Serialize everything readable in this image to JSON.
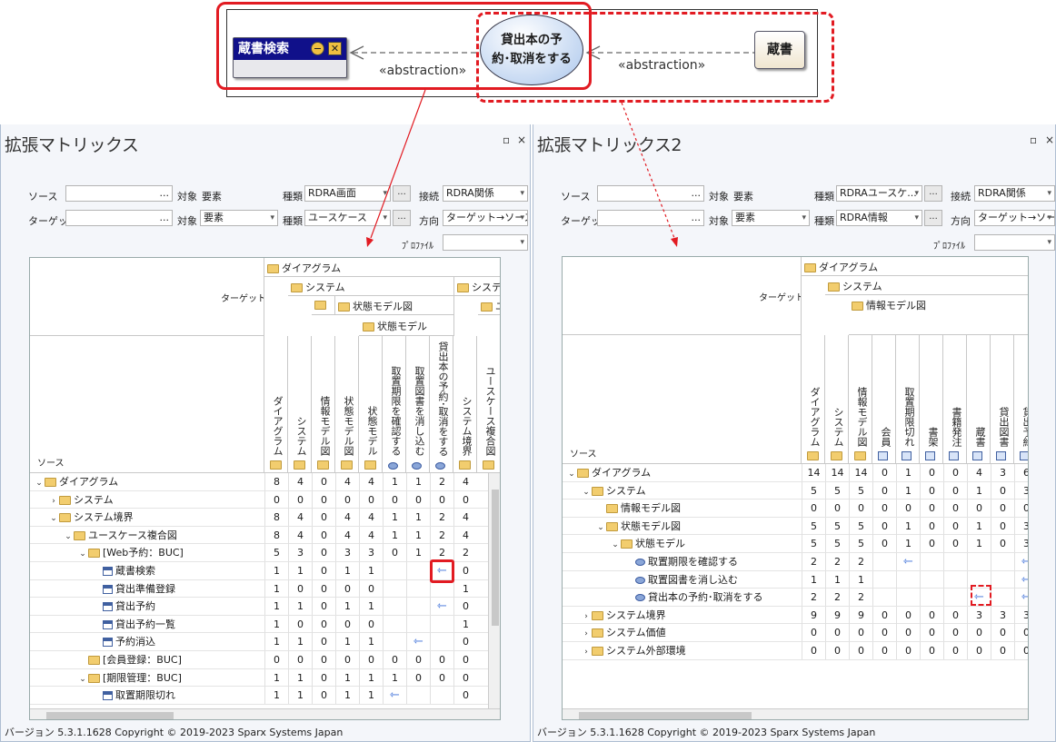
{
  "diagram": {
    "screen_name": "蔵書検索",
    "usecase_line1": "貸出本の予",
    "usecase_line2": "約･取消をする",
    "info_name": "蔵書",
    "abstraction_left": "«abstraction»",
    "abstraction_right": "«abstraction»"
  },
  "panel1": {
    "title": "拡張マトリックス",
    "source_label": "ソース",
    "target_label": "ターゲット",
    "target_kw": "対象",
    "source_target_val": "要素",
    "target_target_val": "要素",
    "kind_label": "種類",
    "source_kind": "RDRA画面",
    "target_kind": "ユースケース",
    "connect_label": "接続",
    "connect_val": "RDRA関係",
    "direction_label": "方向",
    "direction_val": "ターゲット→ソース",
    "profile_label": "ﾌﾟﾛﾌｧｲﾙ",
    "grid_target": "ターゲット",
    "grid_source": "ソース",
    "groups": [
      "ダイアグラム",
      "システム",
      "状態モデル図",
      "状態モデル",
      "システム",
      "ユ"
    ],
    "cols": [
      "ダイアグラム",
      "システム",
      "情報モデル図",
      "状態モデル図",
      "状態モデル",
      "取置期限を確認する",
      "取置図書を消し込む",
      "貸出本の予約･取消をする",
      "システム境界",
      "ユースケース複合図"
    ],
    "rows": [
      {
        "label": "ダイアグラム",
        "vals": [
          "8",
          "4",
          "0",
          "4",
          "4",
          "1",
          "1",
          "2",
          "4"
        ]
      },
      {
        "label": "システム",
        "vals": [
          "0",
          "0",
          "0",
          "0",
          "0",
          "0",
          "0",
          "0",
          "0"
        ]
      },
      {
        "label": "システム境界",
        "vals": [
          "8",
          "4",
          "0",
          "4",
          "4",
          "1",
          "1",
          "2",
          "4"
        ]
      },
      {
        "label": "ユースケース複合図",
        "vals": [
          "8",
          "4",
          "0",
          "4",
          "4",
          "1",
          "1",
          "2",
          "4"
        ]
      },
      {
        "label": "[Web予約：BUC]",
        "vals": [
          "5",
          "3",
          "0",
          "3",
          "3",
          "0",
          "1",
          "2",
          "2"
        ]
      },
      {
        "label": "蔵書検索",
        "vals": [
          "1",
          "1",
          "0",
          "1",
          "1",
          "",
          "",
          "⇽",
          "0"
        ]
      },
      {
        "label": "貸出準備登録",
        "vals": [
          "1",
          "0",
          "0",
          "0",
          "0",
          "",
          "",
          "",
          "1"
        ]
      },
      {
        "label": "貸出予約",
        "vals": [
          "1",
          "1",
          "0",
          "1",
          "1",
          "",
          "",
          "⇽",
          "0"
        ]
      },
      {
        "label": "貸出予約一覧",
        "vals": [
          "1",
          "0",
          "0",
          "0",
          "0",
          "",
          "",
          "",
          "1"
        ]
      },
      {
        "label": "予約消込",
        "vals": [
          "1",
          "1",
          "0",
          "1",
          "1",
          "",
          "⇽",
          "",
          "0"
        ]
      },
      {
        "label": "[会員登録：BUC]",
        "vals": [
          "0",
          "0",
          "0",
          "0",
          "0",
          "0",
          "0",
          "0",
          "0"
        ]
      },
      {
        "label": "[期限管理：BUC]",
        "vals": [
          "1",
          "1",
          "0",
          "1",
          "1",
          "1",
          "0",
          "0",
          "0"
        ]
      },
      {
        "label": "取置期限切れ",
        "vals": [
          "1",
          "1",
          "0",
          "1",
          "1",
          "⇽",
          "",
          "",
          "0"
        ]
      }
    ]
  },
  "panel2": {
    "title": "拡張マトリックス2",
    "source_kind": "RDRAユースケ...",
    "target_kind": "RDRA情報",
    "connect_val": "RDRA関係",
    "direction_val": "ターゲット→ソース",
    "groups": [
      "ダイアグラム",
      "システム",
      "情報モデル図"
    ],
    "cols": [
      "ダイアグラム",
      "システム",
      "情報モデル図",
      "会員",
      "取置期限切れ",
      "書架",
      "書籍発注",
      "蔵書",
      "貸出図書",
      "貸出予約"
    ],
    "rows": [
      {
        "label": "ダイアグラム",
        "vals": [
          "14",
          "14",
          "14",
          "0",
          "1",
          "0",
          "0",
          "4",
          "3",
          "6"
        ]
      },
      {
        "label": "システム",
        "vals": [
          "5",
          "5",
          "5",
          "0",
          "1",
          "0",
          "0",
          "1",
          "0",
          "3"
        ]
      },
      {
        "label": "情報モデル図",
        "vals": [
          "0",
          "0",
          "0",
          "0",
          "0",
          "0",
          "0",
          "0",
          "0",
          "0"
        ]
      },
      {
        "label": "状態モデル図",
        "vals": [
          "5",
          "5",
          "5",
          "0",
          "1",
          "0",
          "0",
          "1",
          "0",
          "3"
        ]
      },
      {
        "label": "状態モデル",
        "vals": [
          "5",
          "5",
          "5",
          "0",
          "1",
          "0",
          "0",
          "1",
          "0",
          "3"
        ]
      },
      {
        "label": "取置期限を確認する",
        "vals": [
          "2",
          "2",
          "2",
          "",
          "⇽",
          "",
          "",
          "",
          "",
          "⇽"
        ]
      },
      {
        "label": "取置図書を消し込む",
        "vals": [
          "1",
          "1",
          "1",
          "",
          "",
          "",
          "",
          "",
          "",
          "⇽"
        ]
      },
      {
        "label": "貸出本の予約･取消をする",
        "vals": [
          "2",
          "2",
          "2",
          "",
          "",
          "",
          "",
          "⇽",
          "",
          "⇽"
        ]
      },
      {
        "label": "システム境界",
        "vals": [
          "9",
          "9",
          "9",
          "0",
          "0",
          "0",
          "0",
          "3",
          "3",
          "3"
        ]
      },
      {
        "label": "システム価値",
        "vals": [
          "0",
          "0",
          "0",
          "0",
          "0",
          "0",
          "0",
          "0",
          "0",
          "0"
        ]
      },
      {
        "label": "システム外部環境",
        "vals": [
          "0",
          "0",
          "0",
          "0",
          "0",
          "0",
          "0",
          "0",
          "0",
          "0"
        ]
      }
    ]
  },
  "footer": "バージョン 5.3.1.1628  Copyright © 2019-2023 Sparx Systems Japan",
  "ellipsis": "...",
  "colors": {
    "accent_red": "#e21b22",
    "screen_blue": "#10108a",
    "arrow_blue": "#3a6ed8"
  }
}
